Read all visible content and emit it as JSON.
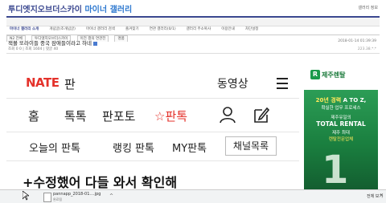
{
  "gallery": {
    "title_main": "투디엣지오브더스카이",
    "title_minor": "마이너 갤러리",
    "top_link": "갤러리 정보",
    "nav": [
      "마이너 갤러리 소개",
      "개념글(조개념글)",
      "마이너 갤러리 검색",
      "즐겨찾기",
      "연관 갤러리(0/1)",
      "갤러리 주소복사",
      "이용안내",
      "차단설정"
    ],
    "tabs": [
      "N2 전체",
      "투디엣지오브더스카이",
      "이전 갤의 연관전",
      "명품"
    ]
  },
  "post": {
    "title": "잭볼 또라이들 중국 잠애들이라고 하네",
    "date": "2018-01-14 01:39:39",
    "meta": "조회 0  0  | 조회  1604  | 댓글  40",
    "ip": "223.38.*.*"
  },
  "nate": {
    "logo": "NATE",
    "pan": "판",
    "video": "동영상",
    "tabs": [
      "홈",
      "톡톡",
      "판포토",
      "판톡"
    ],
    "star": "☆",
    "subtabs": [
      "오늘의 판톡",
      "랭킹 판톡",
      "MY판톡"
    ],
    "channel_button": "채널목록",
    "headline": "+수정했어 다들 와서 확인해"
  },
  "ad": {
    "logo_char": "R",
    "brand": "제주렌탈",
    "line1a": "20년 경력",
    "line1b": "A TO Z,",
    "line2": "확실한 업무 프로세스",
    "line3": "제주유일의",
    "line4": "TOTAL RENTAL",
    "line5": "제주 최대",
    "line6": "렌탈전문업체",
    "number": "1"
  },
  "download": {
    "filename": "pannapp_2018-01....jpg",
    "sub": "완료됨",
    "show_all": "전체 보기",
    "close": "✕",
    "chevron": "^"
  },
  "colors": {
    "nate_red": "#e4322b",
    "gallery_blue": "#3b4890",
    "ad_green": "#1a7f3f"
  }
}
